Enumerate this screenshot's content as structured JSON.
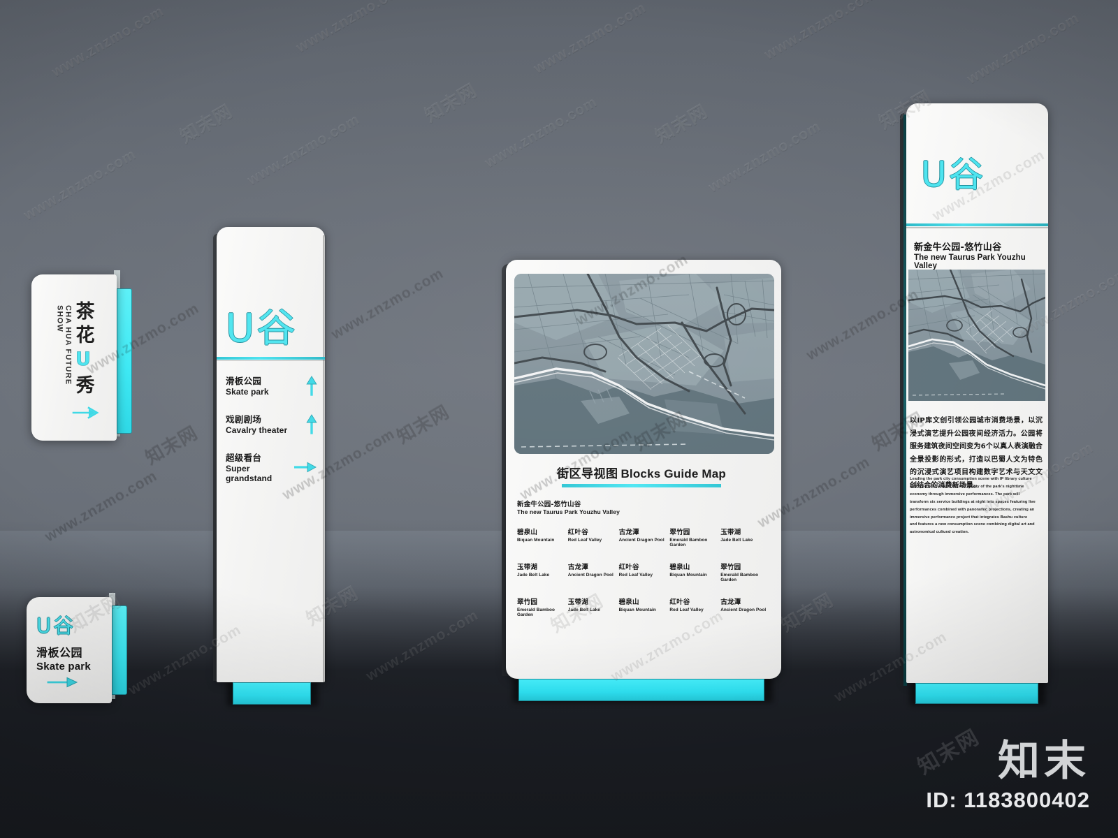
{
  "scene": {
    "accent_cyan": "#4de4ef",
    "accent_cyan_deep": "#2cd8e6",
    "panel_white": "#f4f4f3",
    "wall_gray": "#6a7079",
    "floor_dark": "#1a1d22"
  },
  "sign_showcase": {
    "name": "cha-hua-future-show-sign",
    "cn_chars": [
      "茶",
      "花",
      "U",
      "秀"
    ],
    "cn_line": "茶花U秀",
    "en_line": "CHA HUA FUTURE SHOW",
    "arrow": "right-arrow-icon"
  },
  "sign_skatepark": {
    "name": "skate-park-sign",
    "logo_u": "U",
    "logo_gu": "谷",
    "cn": "滑板公园",
    "en": "Skate park",
    "arrow": "right-arrow-icon"
  },
  "sign_directory": {
    "name": "directory-pylon",
    "logo_u": "U",
    "logo_gu": "谷",
    "items": [
      {
        "cn": "滑板公园",
        "en": "Skate park",
        "arrow": "up-arrow-icon"
      },
      {
        "cn": "戏剧剧场",
        "en": "Cavalry theater",
        "arrow": "up-arrow-icon"
      },
      {
        "cn": "超级看台",
        "en": "Super grandstand",
        "arrow": "right-arrow-icon"
      }
    ]
  },
  "sign_map": {
    "name": "blocks-guide-map-board",
    "title_cn": "街区导视图",
    "title_en": "Blocks Guide Map",
    "subtitle_cn": "新金牛公园-悠竹山谷",
    "subtitle_en": "The new Taurus Park Youzhu Valley",
    "pois": [
      {
        "cn": "碧泉山",
        "en": "Biquan Mountain"
      },
      {
        "cn": "红叶谷",
        "en": "Red Leaf Valley"
      },
      {
        "cn": "古龙潭",
        "en": "Ancient Dragon Pool"
      },
      {
        "cn": "翠竹园",
        "en": "Emerald Bamboo Garden"
      },
      {
        "cn": "玉带湖",
        "en": "Jade Belt Lake"
      },
      {
        "cn": "玉带湖",
        "en": "Jade Belt Lake"
      },
      {
        "cn": "古龙潭",
        "en": "Ancient Dragon Pool"
      },
      {
        "cn": "红叶谷",
        "en": "Red Leaf Valley"
      },
      {
        "cn": "碧泉山",
        "en": "Biquan Mountain"
      },
      {
        "cn": "翠竹园",
        "en": "Emerald Bamboo Garden"
      },
      {
        "cn": "翠竹园",
        "en": "Emerald Bamboo Garden"
      },
      {
        "cn": "玉带湖",
        "en": "Jade Belt Lake"
      },
      {
        "cn": "碧泉山",
        "en": "Biquan Mountain"
      },
      {
        "cn": "红叶谷",
        "en": "Red Leaf Valley"
      },
      {
        "cn": "古龙潭",
        "en": "Ancient Dragon Pool"
      }
    ]
  },
  "sign_info": {
    "name": "park-intro-board",
    "logo_u": "U",
    "logo_gu": "谷",
    "title_cn": "新金牛公园-悠竹山谷",
    "title_en": "The new Taurus Park Youzhu Valley",
    "paragraph_cn": "以IP库文创引领公园城市消费场景，以沉浸式演艺提升公园夜间经济活力。公园将服务建筑夜间空间变为6个以真人表演融合全景投影的形式，打造以巴蜀人文为特色的沉浸式演艺项目构建数字艺术与天文文创结合的消费新场景。",
    "paragraph_en": "Leading the park city consumption scene with IP library culture and creativity, enhancing the vitality of the park's nighttime economy through immersive performances. The park will transform six service buildings at night into spaces featuring live performances combined with panoramic projections, creating an immersive performance project that integrates Bashu culture and features a new consumption scene combining digital art and astronomical cultural creation."
  },
  "watermarks": {
    "url_text": "www.znzmo.com",
    "cn_text": "知末网",
    "brand_logo": "知末",
    "brand_id": "ID: 1183800402"
  }
}
